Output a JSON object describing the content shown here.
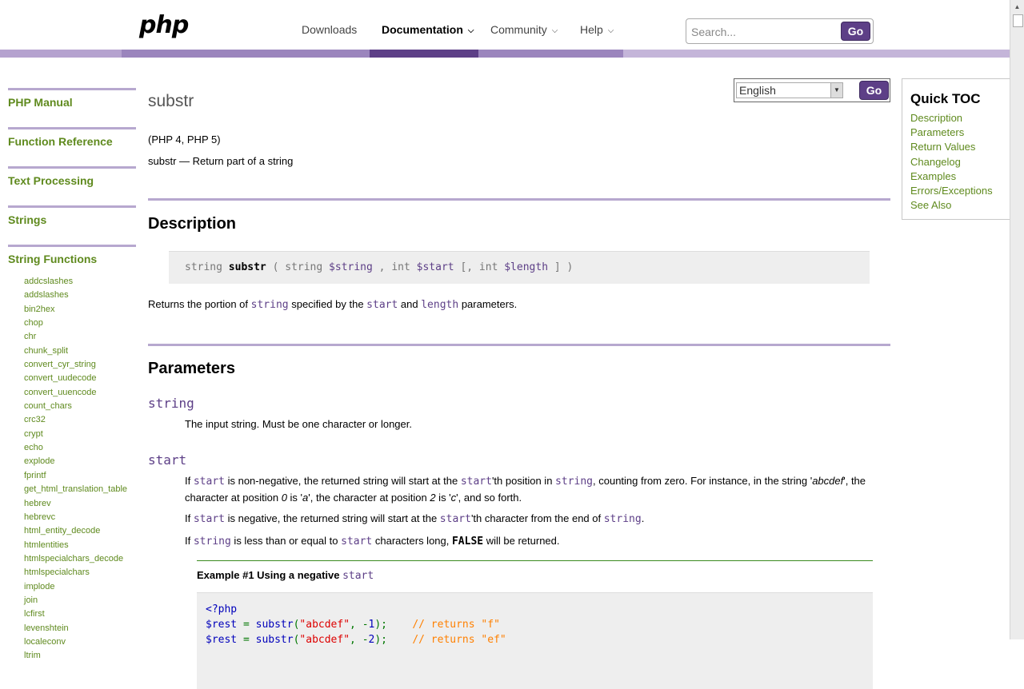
{
  "header": {
    "logo": "php",
    "nav": [
      {
        "label": "Downloads",
        "has_menu": false,
        "active": false
      },
      {
        "label": "Documentation",
        "has_menu": true,
        "active": true
      },
      {
        "label": "Community",
        "has_menu": true,
        "active": false
      },
      {
        "label": "Help",
        "has_menu": true,
        "active": false
      }
    ],
    "search_placeholder": "Search...",
    "search_button": "Go"
  },
  "sidebar": {
    "sections": [
      "PHP Manual",
      "Function Reference",
      "Text Processing",
      "Strings",
      "String Functions"
    ],
    "functions": [
      "addcslashes",
      "addslashes",
      "bin2hex",
      "chop",
      "chr",
      "chunk_split",
      "convert_cyr_string",
      "convert_uudecode",
      "convert_uuencode",
      "count_chars",
      "crc32",
      "crypt",
      "echo",
      "explode",
      "fprintf",
      "get_html_translation_table",
      "hebrev",
      "hebrevc",
      "html_entity_decode",
      "htmlentities",
      "htmlspecialchars_decode",
      "htmlspecialchars",
      "implode",
      "join",
      "lcfirst",
      "levenshtein",
      "localeconv",
      "ltrim"
    ]
  },
  "language": {
    "selected": "English",
    "button": "Go"
  },
  "page": {
    "title": "substr",
    "version": "(PHP 4, PHP 5)",
    "refpurpose": "substr — Return part of a string",
    "description_heading": "Description",
    "synopsis": {
      "return_type": "string",
      "name": "substr",
      "open": "(",
      "p1_type": "string",
      "p1_var": "$string",
      "sep": ",",
      "p2_type": "int",
      "p2_var": "$start",
      "opt": "[,",
      "p3_type": "int",
      "p3_var": "$length",
      "close": "] )"
    },
    "returns_desc": {
      "t1": "Returns the portion of ",
      "c1": "string",
      "t2": " specified by the ",
      "c2": "start",
      "t3": " and ",
      "c3": "length",
      "t4": " parameters."
    },
    "parameters_heading": "Parameters",
    "param_string": {
      "name": "string",
      "desc": "The input string. Must be one character or longer."
    },
    "param_start": {
      "name": "start",
      "p1": {
        "t1": "If ",
        "c1": "start",
        "t2": " is non-negative, the returned string will start at the ",
        "c2": "start",
        "t3": "'th position in ",
        "c3": "string",
        "t4": ", counting from zero. For instance, in the string '",
        "i1": "abcdef",
        "t5": "', the character at position ",
        "i2": "0",
        "t6": " is '",
        "i3": "a",
        "t7": "', the character at position ",
        "i4": "2",
        "t8": " is '",
        "i5": "c",
        "t9": "', and so forth."
      },
      "p2": {
        "t1": "If ",
        "c1": "start",
        "t2": " is negative, the returned string will start at the ",
        "c2": "start",
        "t3": "'th character from the end of ",
        "c3": "string",
        "t4": "."
      },
      "p3": {
        "t1": "If ",
        "c1": "string",
        "t2": " is less than or equal to ",
        "c2": "start",
        "t3": " characters long, ",
        "c3": "FALSE",
        "t4": " will be returned."
      }
    },
    "example": {
      "title": "Example #1 Using a negative ",
      "title_code": "start",
      "line1": "<?php",
      "line2_var": "$rest",
      "line2_op": " = ",
      "line2_fn": "substr",
      "line2_open": "(",
      "line2_str": "\"abcdef\"",
      "line2_args": ", -",
      "line2_num": "1",
      "line2_close": ");",
      "line2_cm": "    // returns \"f\"",
      "line3_var": "$rest",
      "line3_op": " = ",
      "line3_fn": "substr",
      "line3_open": "(",
      "line3_str": "\"abcdef\"",
      "line3_args": ", -",
      "line3_num": "2",
      "line3_close": ");",
      "line3_cm": "    // returns \"ef\""
    }
  },
  "toc": {
    "title": "Quick TOC",
    "items": [
      "Description",
      "Parameters",
      "Return Values",
      "Changelog",
      "Examples",
      "Errors/Exceptions",
      "See Also"
    ]
  }
}
